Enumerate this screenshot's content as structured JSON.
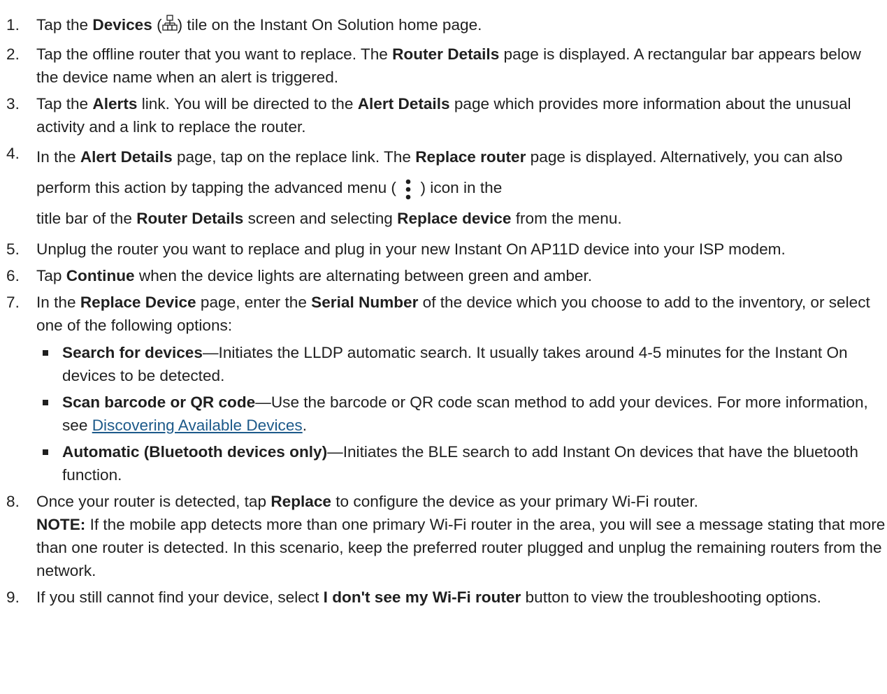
{
  "steps": [
    {
      "num": "1.",
      "a": "Tap the ",
      "b": "Devices",
      "c": " (",
      "d": ") tile on the Instant On Solution home page."
    },
    {
      "num": "2.",
      "a": "Tap the offline router that you want to replace. The ",
      "b": "Router Details",
      "c": " page is displayed. A rectangular bar appears below the device name when an alert is triggered."
    },
    {
      "num": "3.",
      "a": "Tap the ",
      "b": "Alerts",
      "c": " link. You will be directed to the ",
      "d": "Alert Details",
      "e": " page which provides more information about the unusual activity and a link to replace the router."
    },
    {
      "num": "4.",
      "a": "In the ",
      "b": "Alert Details",
      "c": " page, tap on the replace link. The ",
      "d": "Replace router",
      "e": " page is displayed. Alternatively, you can also perform this action by tapping the advanced menu ( ",
      "f": " ) icon in the",
      "g": "title bar of the ",
      "h": "Router Details",
      "i": " screen and selecting ",
      "j": "Replace device",
      "k": " from the menu."
    },
    {
      "num": "5.",
      "a": "Unplug the router you want to replace and plug in your new Instant On AP11D device into your ISP modem."
    },
    {
      "num": "6.",
      "a": "Tap ",
      "b": "Continue",
      "c": " when the device lights are alternating between green and amber."
    },
    {
      "num": "7.",
      "a": "In the ",
      "b": "Replace Device",
      "c": " page, enter the ",
      "d": "Serial Number",
      "e": " of the device which you choose to add to the inventory, or select one of the following options:",
      "options": [
        {
          "b": "Search for devices",
          "a": "—Initiates the LLDP automatic search. It usually takes around 4-5 minutes for the Instant On devices to be detected."
        },
        {
          "b": "Scan barcode or QR code",
          "a": "—Use the barcode or QR code scan method to add your devices. For more information, see ",
          "link": "Discovering Available Devices",
          "end": "."
        },
        {
          "b": "Automatic (Bluetooth devices only)",
          "a": "—Initiates the BLE search to add Instant On devices that have the bluetooth function."
        }
      ]
    },
    {
      "num": "8.",
      "a": "Once your router is detected, tap ",
      "b": "Replace",
      "c": " to configure the device as your primary Wi-Fi router.",
      "note_label": "NOTE:",
      "note": " If the mobile app detects more than one primary Wi-Fi router in the area, you will see a message stating that more than one router is detected. In this scenario, keep the preferred router plugged and unplug the remaining routers from the network."
    },
    {
      "num": "9.",
      "a": "If you still cannot find your device, select ",
      "b": "I don't see my Wi-Fi router",
      "c": " button to view the troubleshooting options."
    }
  ],
  "icons": {
    "devices": "devices-topology-icon",
    "menu": "vertical-ellipsis-icon"
  },
  "colors": {
    "text": "#1f1f1f",
    "link": "#1d5a8a"
  }
}
